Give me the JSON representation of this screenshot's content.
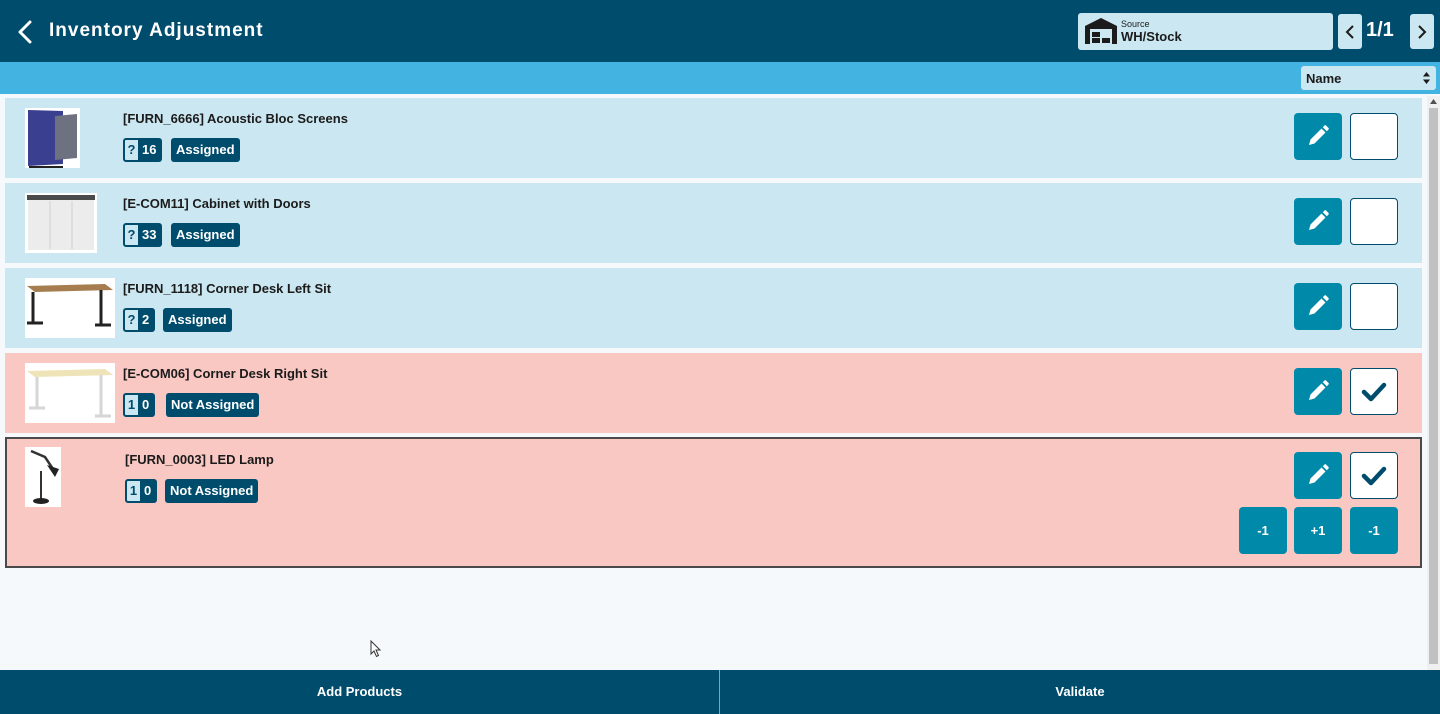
{
  "header": {
    "title": "Inventory Adjustment",
    "source_label": "Source",
    "source_value": "WH/Stock",
    "pager": "1/1"
  },
  "sort": {
    "selected": "Name"
  },
  "products": [
    {
      "name": "[FURN_6666] Acoustic Bloc Screens",
      "qty_a": "?",
      "qty_b": "16",
      "status": "Assigned",
      "checked": false
    },
    {
      "name": "[E-COM11] Cabinet with Doors",
      "qty_a": "?",
      "qty_b": "33",
      "status": "Assigned",
      "checked": false
    },
    {
      "name": "[FURN_1118] Corner Desk Left Sit",
      "qty_a": "?",
      "qty_b": "2",
      "status": "Assigned",
      "checked": false
    },
    {
      "name": "[E-COM06] Corner Desk Right Sit",
      "qty_a": "1",
      "qty_b": "0",
      "status": "Not Assigned",
      "checked": true
    },
    {
      "name": "[FURN_0003] LED Lamp",
      "qty_a": "1",
      "qty_b": "0",
      "status": "Not Assigned",
      "checked": true,
      "steps": [
        "-1",
        "+1",
        "-1"
      ]
    }
  ],
  "footer": {
    "add_products": "Add Products",
    "validate": "Validate"
  },
  "colors": {
    "header": "#004c6d",
    "subbar": "#43b3e1",
    "assigned_row": "#cbe7f1",
    "not_assigned_row": "#f9c8c3",
    "action_button": "#0089a8"
  }
}
